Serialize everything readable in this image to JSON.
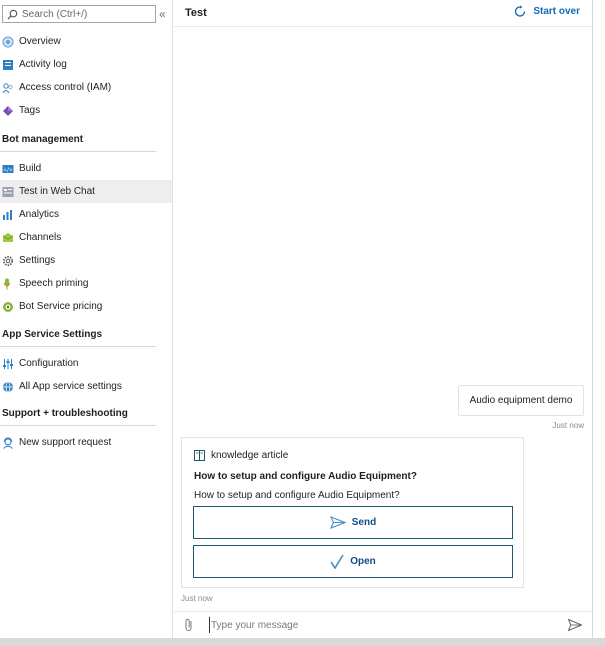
{
  "search": {
    "placeholder": "Search (Ctrl+/)"
  },
  "sidebar": {
    "top_items": [
      {
        "label": "Overview",
        "icon": "overview-icon"
      },
      {
        "label": "Activity log",
        "icon": "activity-log-icon"
      },
      {
        "label": "Access control (IAM)",
        "icon": "people-icon"
      },
      {
        "label": "Tags",
        "icon": "tag-icon"
      }
    ],
    "bot_management": {
      "header": "Bot management",
      "items": [
        {
          "label": "Build",
          "icon": "code-icon"
        },
        {
          "label": "Test in Web Chat",
          "icon": "web-chat-icon",
          "active": true
        },
        {
          "label": "Analytics",
          "icon": "analytics-icon"
        },
        {
          "label": "Channels",
          "icon": "channels-icon"
        },
        {
          "label": "Settings",
          "icon": "gear-icon"
        },
        {
          "label": "Speech priming",
          "icon": "speech-icon"
        },
        {
          "label": "Bot Service pricing",
          "icon": "pricing-icon"
        }
      ]
    },
    "app_service": {
      "header": "App Service Settings",
      "items": [
        {
          "label": "Configuration",
          "icon": "sliders-icon"
        },
        {
          "label": "All App service settings",
          "icon": "globe-icon"
        }
      ]
    },
    "support": {
      "header": "Support + troubleshooting",
      "items": [
        {
          "label": "New support request",
          "icon": "support-icon"
        }
      ]
    }
  },
  "chat": {
    "title": "Test",
    "start_over": "Start over",
    "user_message": "Audio equipment demo",
    "user_time": "Just now",
    "card": {
      "subtitle": "knowledge article",
      "title": "How to setup and configure Audio Equipment?",
      "text": "How to setup and configure Audio Equipment?",
      "send_label": "Send",
      "open_label": "Open"
    },
    "bot_time": "Just now",
    "input_placeholder": "Type your message"
  },
  "colors": {
    "accent": "#0f6cbd",
    "active_bg": "#eeeeee",
    "button_border": "#1c5a6a"
  }
}
